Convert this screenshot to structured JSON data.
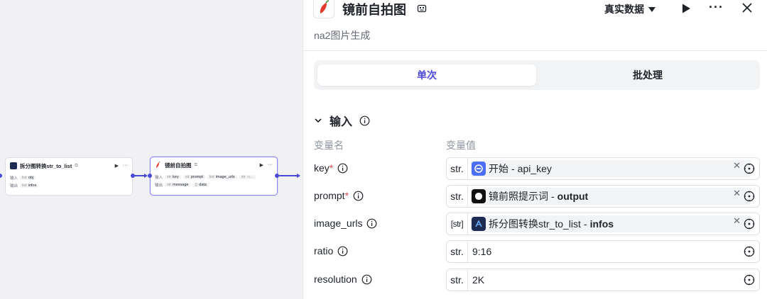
{
  "canvas": {
    "node1": {
      "title": "拆分图转换str_to_list",
      "input_label": "输入",
      "input_type": "list",
      "input_name": "obj",
      "output_label": "输出",
      "output_type": "list",
      "output_name": "infos"
    },
    "node2": {
      "title": "镜前自拍图",
      "input_label": "输入",
      "inputs": [
        {
          "type": "str",
          "name": "key"
        },
        {
          "type": "str",
          "name": "prompt"
        },
        {
          "type": "list",
          "name": "image_urls"
        },
        {
          "type": "str",
          "name": "ra..."
        }
      ],
      "output_label": "输出",
      "outputs": [
        {
          "type": "str",
          "name": "message"
        },
        {
          "type": "{}",
          "name": "data"
        }
      ]
    },
    "colors": {
      "edge": "#4c48d6",
      "node_border_selected": "#8c85f5"
    }
  },
  "panel": {
    "title": "镜前自拍图",
    "subtitle": "na2图片生成",
    "mode": "真实数据",
    "more": "···",
    "tabs": [
      {
        "label": "单次",
        "active": true
      },
      {
        "label": "批处理",
        "active": false
      }
    ],
    "section_title": "输入",
    "col_name": "变量名",
    "col_value": "变量值",
    "rows": [
      {
        "label": "key",
        "required": true,
        "type": "str.",
        "kind": "ref",
        "source": "开始",
        "var": "api_key",
        "icon": "start-icon"
      },
      {
        "label": "prompt",
        "required": true,
        "type": "str.",
        "kind": "ref",
        "source": "镜前照提示词",
        "var": "output",
        "icon": "llm-icon"
      },
      {
        "label": "image_urls",
        "required": false,
        "type": "[str]",
        "kind": "ref",
        "source": "拆分图转换str_to_list",
        "var": "infos",
        "icon": "code-icon"
      },
      {
        "label": "ratio",
        "required": false,
        "type": "str.",
        "kind": "value",
        "value": "9:16"
      },
      {
        "label": "resolution",
        "required": false,
        "type": "str.",
        "kind": "value",
        "value": "2K"
      }
    ],
    "colors": {
      "accent": "#4c48d6",
      "required": "#e5484d"
    }
  }
}
